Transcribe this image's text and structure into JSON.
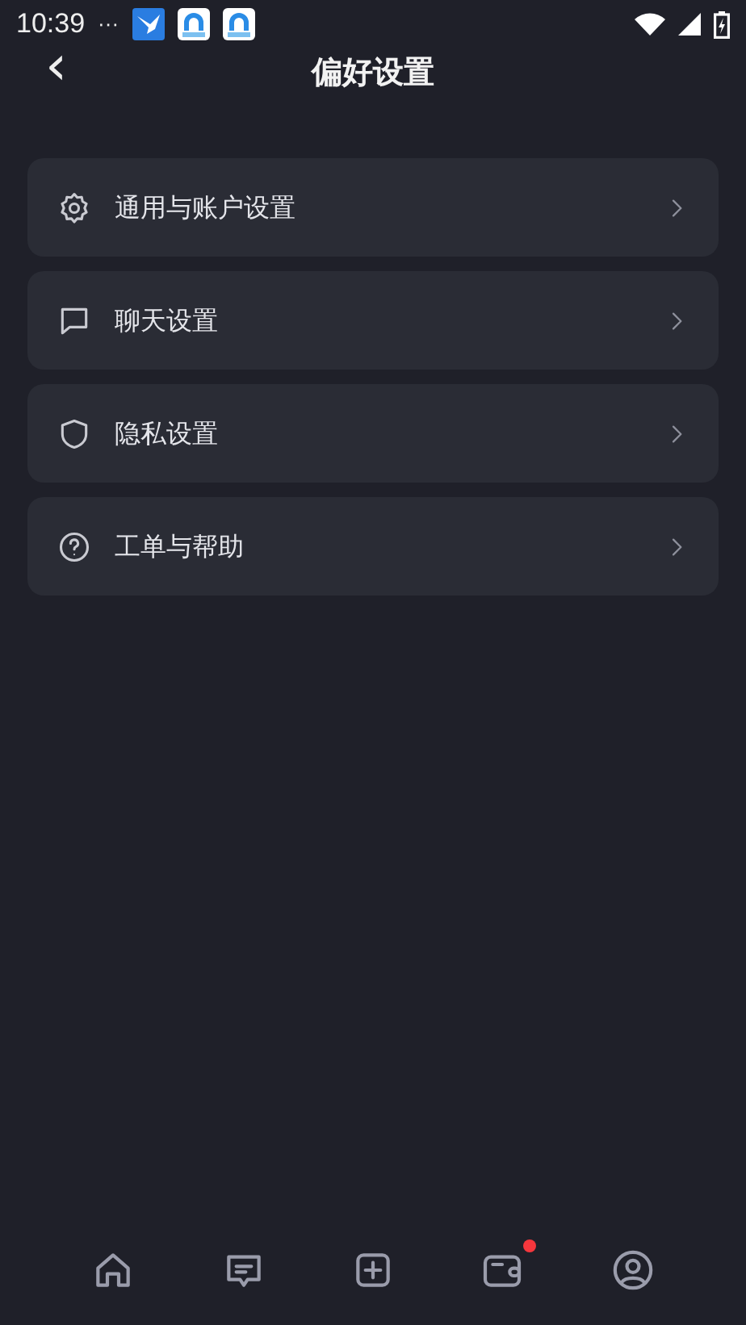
{
  "status_bar": {
    "time": "10:39",
    "overflow": "···"
  },
  "header": {
    "back": "‹",
    "title": "偏好设置"
  },
  "menu_items": [
    {
      "label": "通用与账户设置",
      "kind": "gear"
    },
    {
      "label": "聊天设置",
      "kind": "chat"
    },
    {
      "label": "隐私设置",
      "kind": "shield"
    },
    {
      "label": "工单与帮助",
      "kind": "help"
    }
  ],
  "bottom_nav": [
    {
      "kind": "home",
      "badge": false
    },
    {
      "kind": "message",
      "badge": false
    },
    {
      "kind": "add",
      "badge": false
    },
    {
      "kind": "wallet",
      "badge": true
    },
    {
      "kind": "profile",
      "badge": false
    }
  ]
}
